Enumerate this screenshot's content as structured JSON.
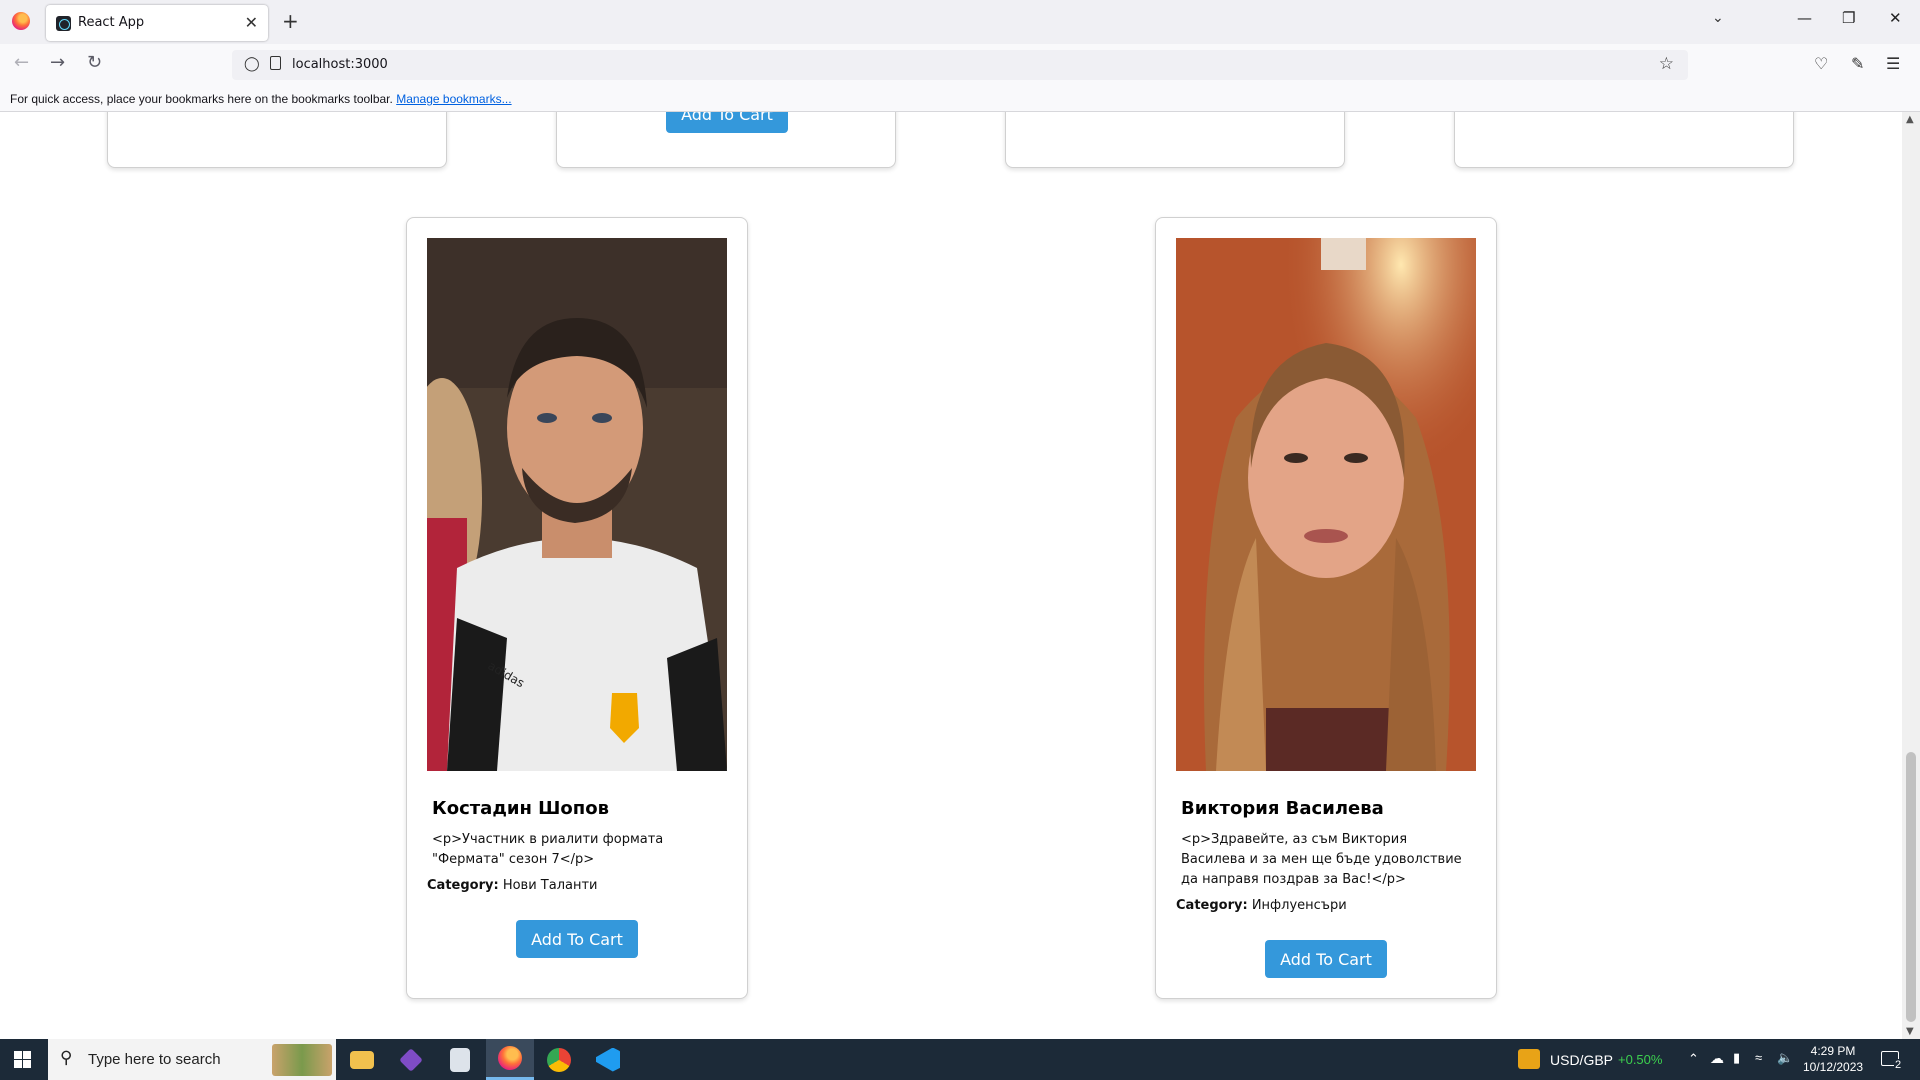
{
  "browser": {
    "tab_title": "React App",
    "tab_close": "✕",
    "new_tab": "+",
    "url": "localhost:3000",
    "bookmarks_text": "For quick access, place your bookmarks here on the bookmarks toolbar.",
    "bookmarks_link": "Manage bookmarks..."
  },
  "top_cards": {
    "button_label": "Add To Cart"
  },
  "products": [
    {
      "name": "Костадин Шопов",
      "description": "<p>Участник в риалити формата \"Фермата\" сезон 7</p>",
      "category_label": "Category:",
      "category": "Нови Таланти",
      "button_label": "Add To Cart"
    },
    {
      "name": "Виктория Василева",
      "description": "<p>Здравейте, аз съм Виктория Василева и за мен ще бъде удоволствие да направя поздрав за Вас!</p>",
      "category_label": "Category:",
      "category": "Инфлуенсъри",
      "button_label": "Add To Cart"
    }
  ],
  "taskbar": {
    "search_placeholder": "Type here to search",
    "ticker": "USD/GBP",
    "ticker_change": "+0.50%",
    "time": "4:29 PM",
    "date": "10/12/2023",
    "notifications": "2",
    "colors": {
      "ticker_up": "#3ccf4e",
      "accent": "#3498db"
    }
  }
}
